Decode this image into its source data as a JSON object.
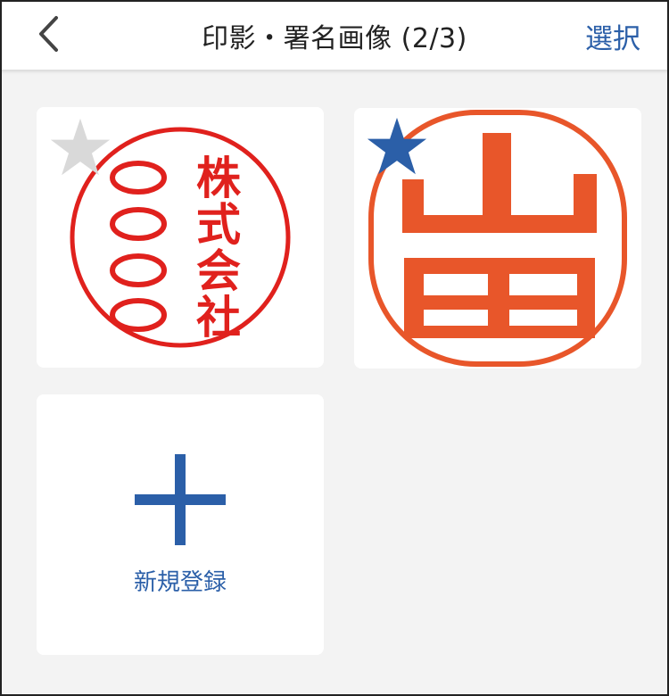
{
  "header": {
    "back_icon": "chevron-left-icon",
    "title": "印影・署名画像 (2/3)",
    "select_label": "選択"
  },
  "colors": {
    "accent": "#2b5fa8",
    "star_inactive": "#d9d9d9",
    "star_active": "#2b5fa8",
    "stamp_red": "#e0211d",
    "stamp_orange": "#e8562a",
    "background": "#f3f3f3"
  },
  "seals": [
    {
      "favorite": false,
      "star_icon": "star-icon",
      "stamp_text": "株式会社〇〇〇〇"
    },
    {
      "favorite": true,
      "star_icon": "star-icon",
      "stamp_text": "山田"
    }
  ],
  "add_card": {
    "icon": "plus-icon",
    "label": "新規登録"
  }
}
